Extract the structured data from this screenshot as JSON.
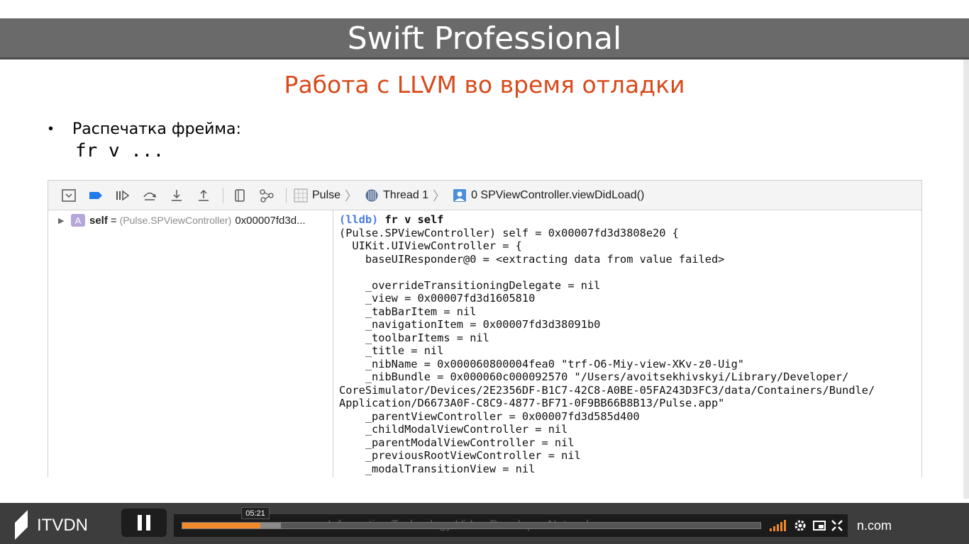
{
  "slide": {
    "title": "Swift Professional",
    "subtitle": "Работа с LLVM во время отладки",
    "bullet_symbol": "•",
    "bullet_text": "Распечатка фрейма:",
    "command": "fr v ..."
  },
  "debugger": {
    "toolbar": {
      "breadcrumb_app": "Pulse",
      "breadcrumb_thread": "Thread 1",
      "breadcrumb_frame": "0 SPViewController.viewDidLoad()",
      "active_color": "#1f7aed"
    },
    "variables": [
      {
        "badge": "A",
        "name": "self",
        "eq": "=",
        "type": "(Pulse.SPViewController)",
        "value": "0x00007fd3d..."
      }
    ],
    "console": {
      "prompt": "(lldb)",
      "command": " fr v self",
      "lines": [
        "(Pulse.SPViewController) self = 0x00007fd3d3808e20 {",
        "  UIKit.UIViewController = {",
        "    baseUIResponder@0 = <extracting data from value failed>",
        "",
        "    _overrideTransitioningDelegate = nil",
        "    _view = 0x00007fd3d1605810",
        "    _tabBarItem = nil",
        "    _navigationItem = 0x00007fd3d38091b0",
        "    _toolbarItems = nil",
        "    _title = nil",
        "    _nibName = 0x000060800004fea0 \"trf-O6-Miy-view-XKv-z0-Uig\"",
        "    _nibBundle = 0x000060c000092570 \"/Users/avoitsekhivskyi/Library/Developer/",
        "CoreSimulator/Devices/2E2356DF-B1C7-42C8-A0BE-05FA243D3FC3/data/Containers/Bundle/",
        "Application/D6673A0F-C8C9-4877-BF71-0F9BB66B8B13/Pulse.app\"",
        "    _parentViewController = 0x00007fd3d585d400",
        "    _childModalViewController = nil",
        "    _parentModalViewController = nil",
        "    _previousRootViewController = nil",
        "    _modalTransitionView = nil"
      ]
    }
  },
  "player": {
    "logo_text": "ITVDN",
    "current_time": "05:21",
    "progress_fraction": 0.135,
    "buffered_fraction": 0.17,
    "watermark": "Information Technology Video Developer Network",
    "domain_text": "n.com",
    "accent_color": "#f08a2c",
    "icons": [
      "pause-icon",
      "volume-icon",
      "settings-icon",
      "pip-icon",
      "fullscreen-icon"
    ]
  }
}
